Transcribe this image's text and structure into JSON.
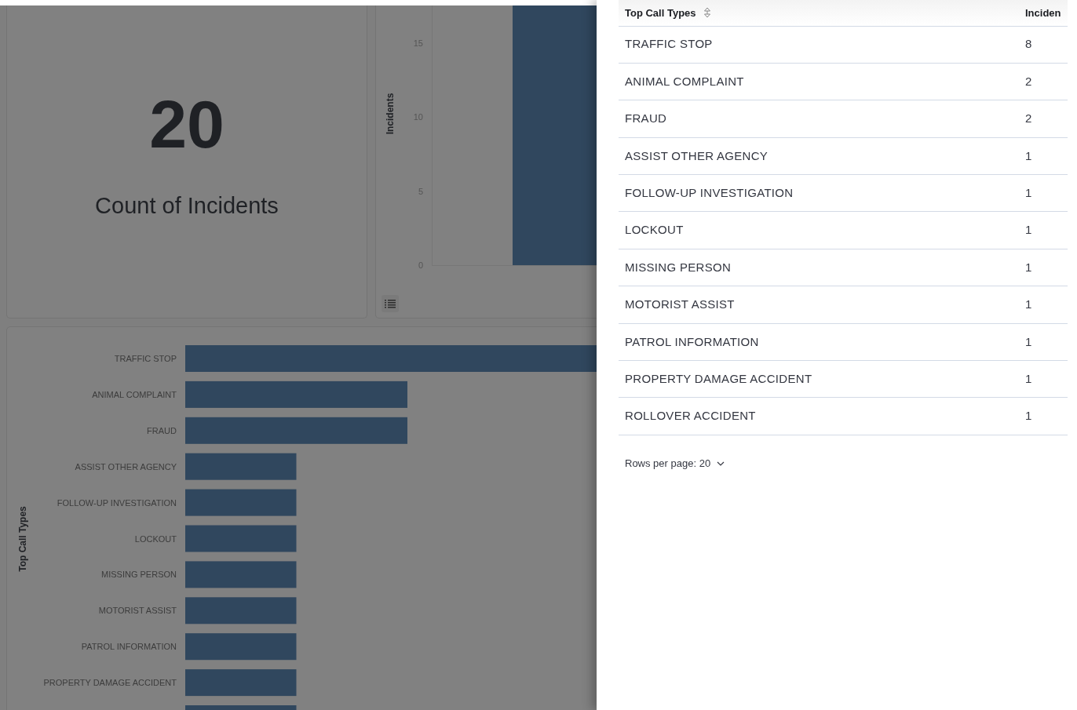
{
  "kpi": {
    "value": "20",
    "label": "Count of Incidents"
  },
  "incidents_chart": {
    "axis_title": "Incidents",
    "tick_labels": [
      "15",
      "10",
      "5",
      "0"
    ]
  },
  "call_types_chart": {
    "axis_title": "Top Call Types",
    "category_labels": [
      "TRAFFIC STOP",
      "ANIMAL COMPLAINT",
      "FRAUD",
      "ASSIST OTHER AGENCY",
      "FOLLOW-UP INVESTIGATION",
      "LOCKOUT",
      "MISSING PERSON",
      "MOTORIST ASSIST",
      "PATROL INFORMATION",
      "PROPERTY DAMAGE ACCIDENT"
    ]
  },
  "table": {
    "columns": [
      "Top Call Types",
      "Inciden"
    ],
    "rows": [
      [
        "TRAFFIC STOP",
        "8"
      ],
      [
        "ANIMAL COMPLAINT",
        "2"
      ],
      [
        "FRAUD",
        "2"
      ],
      [
        "ASSIST OTHER AGENCY",
        "1"
      ],
      [
        "FOLLOW-UP INVESTIGATION",
        "1"
      ],
      [
        "LOCKOUT",
        "1"
      ],
      [
        "MISSING PERSON",
        "1"
      ],
      [
        "MOTORIST ASSIST",
        "1"
      ],
      [
        "PATROL INFORMATION",
        "1"
      ],
      [
        "PROPERTY DAMAGE ACCIDENT",
        "1"
      ],
      [
        "ROLLOVER ACCIDENT",
        "1"
      ]
    ],
    "rows_per_page": "Rows per page: 20"
  }
}
